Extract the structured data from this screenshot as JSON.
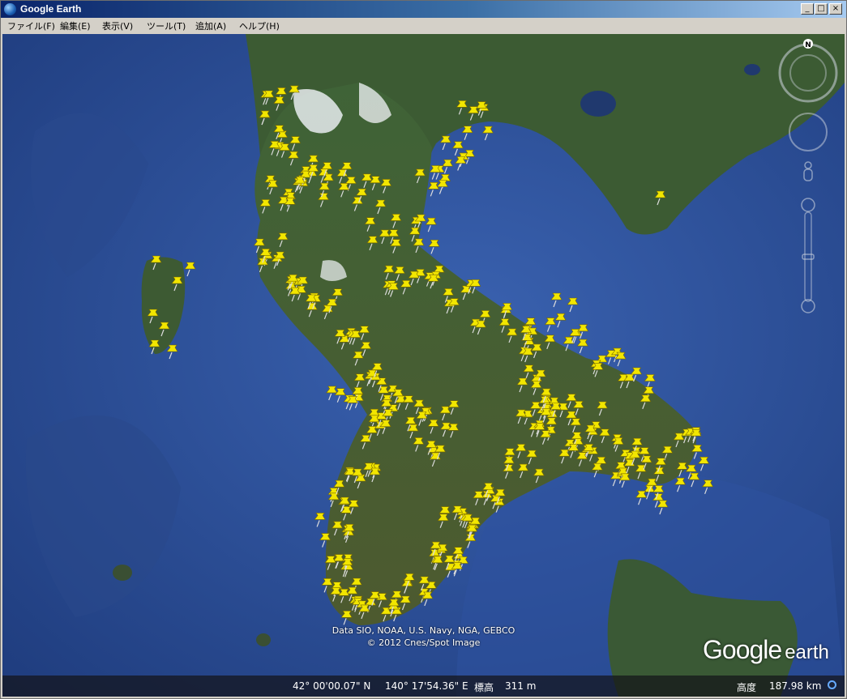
{
  "window": {
    "title": "Google Earth",
    "minimize": "_",
    "maximize": "□",
    "close": "×"
  },
  "menu": [
    "ファイル(F)",
    "編集(E)",
    "表示(V)",
    "ツール(T)",
    "追加(A)",
    "ヘルプ(H)"
  ],
  "compass": {
    "north": "N"
  },
  "attribution": {
    "line1": "Data SIO, NOAA, U.S. Navy, NGA, GEBCO",
    "line2": "© 2012 Cnes/Spot Image"
  },
  "logo": {
    "google": "Google",
    "earth": "earth"
  },
  "status": {
    "latitude": "42° 00'00.07\" N",
    "longitude": "140° 17'54.36\" E",
    "elevation_label": "標高",
    "elevation": "311 m",
    "altitude_label": "高度",
    "altitude": "187.98 km"
  },
  "placemark_count": 380,
  "colors": {
    "placemark": "#f2e600",
    "water": "#2c4f9a",
    "land": "#3e5f2e",
    "titlebar": "#0a246a"
  }
}
